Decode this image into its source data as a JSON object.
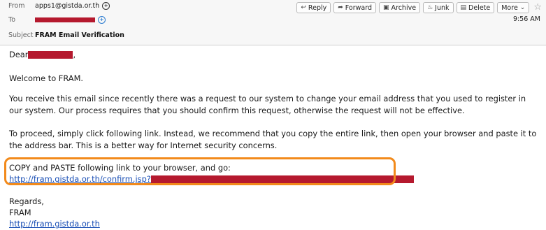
{
  "header": {
    "from_label": "From",
    "from_value": "apps1@gistda.or.th",
    "to_label": "To",
    "subject_label": "Subject",
    "subject_value": "FRAM Email Verification",
    "time": "9:56 AM"
  },
  "toolbar": {
    "reply": "Reply",
    "forward": "Forward",
    "archive": "Archive",
    "junk": "Junk",
    "delete": "Delete",
    "more": "More"
  },
  "body": {
    "greeting": "Dear",
    "greeting_suffix": ",",
    "welcome": "Welcome to FRAM.",
    "receive": "You receive this email since recently there was a request to our system to change your email address that you used to register in our system. Our process requires that you should confirm this request, otherwise the request will not be effective.",
    "proceed": "To proceed, simply click following link. Instead, we recommend that you copy the entire link, then open your browser and paste it to the address bar. This is a better way for Internet security concerns.",
    "copy_instruction": "COPY and PASTE following link to your browser, and go:",
    "link_text": "http://fram.gistda.or.th/confirm.jsp?",
    "regards": "Regards,",
    "signature": "FRAM",
    "site_link": "http://fram.gistda.or.th"
  },
  "icons": {
    "reply": "reply-arrow",
    "forward": "forward-arrow",
    "archive": "archive-box",
    "junk": "junk-flame",
    "delete": "trash-can",
    "more": "chevron-down",
    "star": "star-outline"
  },
  "colors": {
    "highlight": "#f28a1b",
    "redaction": "#b5192e",
    "link": "#1a4fb5"
  }
}
